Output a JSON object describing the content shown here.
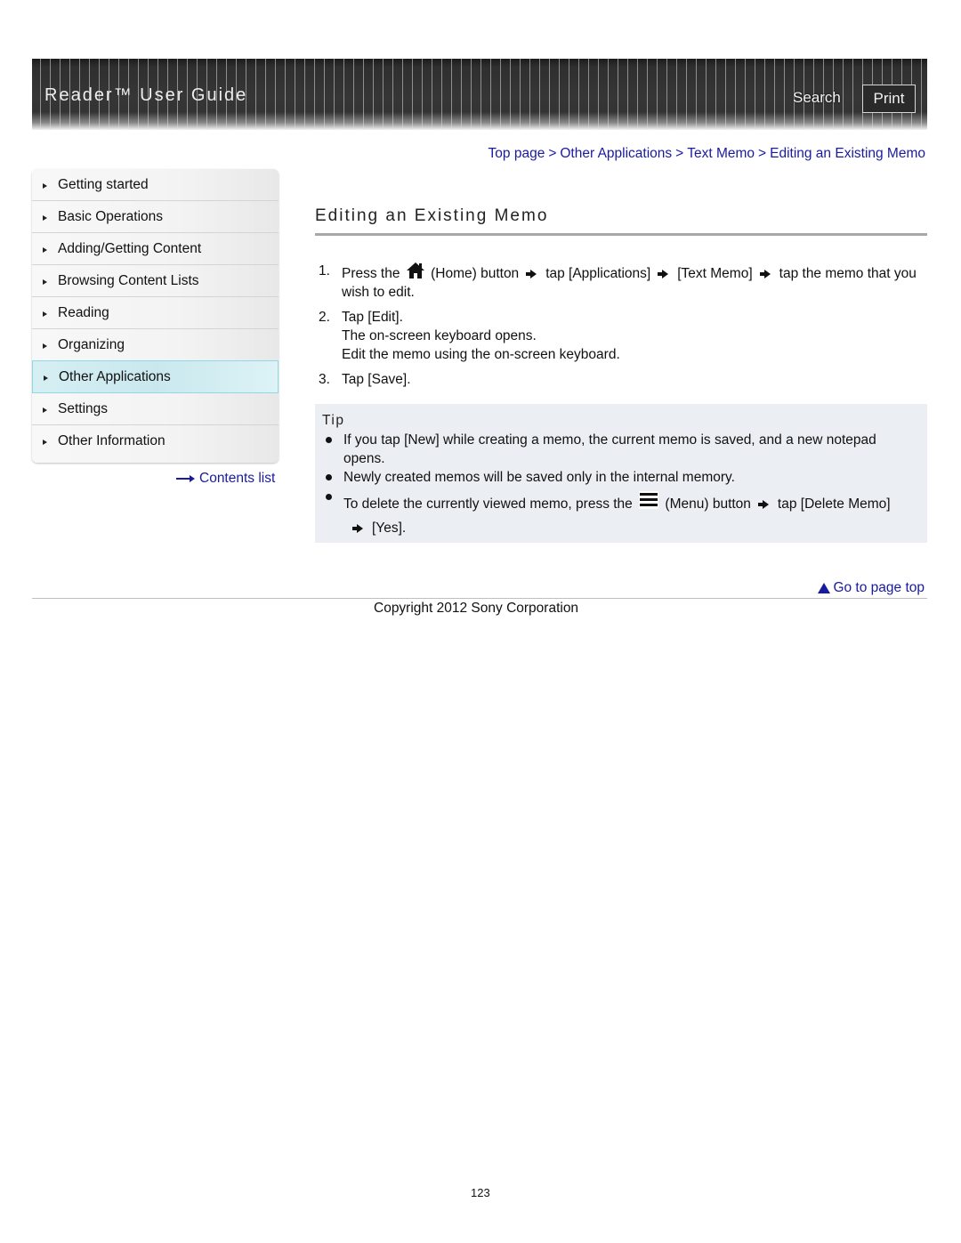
{
  "header": {
    "title": "Reader™ User Guide",
    "search_label": "Search",
    "print_label": "Print"
  },
  "breadcrumb": {
    "items": [
      "Top page",
      "Other Applications",
      "Text Memo",
      "Editing an Existing Memo"
    ],
    "separator": ">"
  },
  "sidebar": {
    "items": [
      {
        "label": "Getting started"
      },
      {
        "label": "Basic Operations"
      },
      {
        "label": "Adding/Getting Content"
      },
      {
        "label": "Browsing Content Lists"
      },
      {
        "label": "Reading"
      },
      {
        "label": "Organizing"
      },
      {
        "label": "Other Applications",
        "active": true
      },
      {
        "label": "Settings"
      },
      {
        "label": "Other Information"
      }
    ],
    "contents_link": "Contents list"
  },
  "main": {
    "title": "Editing an Existing Memo",
    "steps": [
      {
        "num": "1.",
        "parts": {
          "a": "Press the",
          "icon": "home-icon",
          "b": "(Home) button",
          "c": "tap [Applications]",
          "d": "[Text Memo]",
          "e": "tap the memo that you wish to edit."
        }
      },
      {
        "num": "2.",
        "text": "Tap [Edit].",
        "sub": [
          "The on-screen keyboard opens.",
          "Edit the memo using the on-screen keyboard."
        ]
      },
      {
        "num": "3.",
        "text": "Tap [Save]."
      }
    ],
    "tip": {
      "title": "Tip",
      "items": [
        {
          "text": "If you tap [New] while creating a memo, the current memo is saved, and a new notepad opens."
        },
        {
          "text": "Newly created memos will be saved only in the internal memory."
        },
        {
          "a": "To delete the currently viewed memo, press the",
          "icon": "menu-icon",
          "b": "(Menu) button",
          "c": "tap [Delete Memo]",
          "d": "[Yes]."
        }
      ]
    }
  },
  "footer": {
    "go_to_top": "Go to page top",
    "copyright": "Copyright 2012 Sony Corporation",
    "page_number": "123"
  },
  "colors": {
    "link": "#1a1aa0",
    "tip_background": "#ebeef3",
    "active_nav": "#c9e8ee",
    "header_dark": "#333333"
  }
}
